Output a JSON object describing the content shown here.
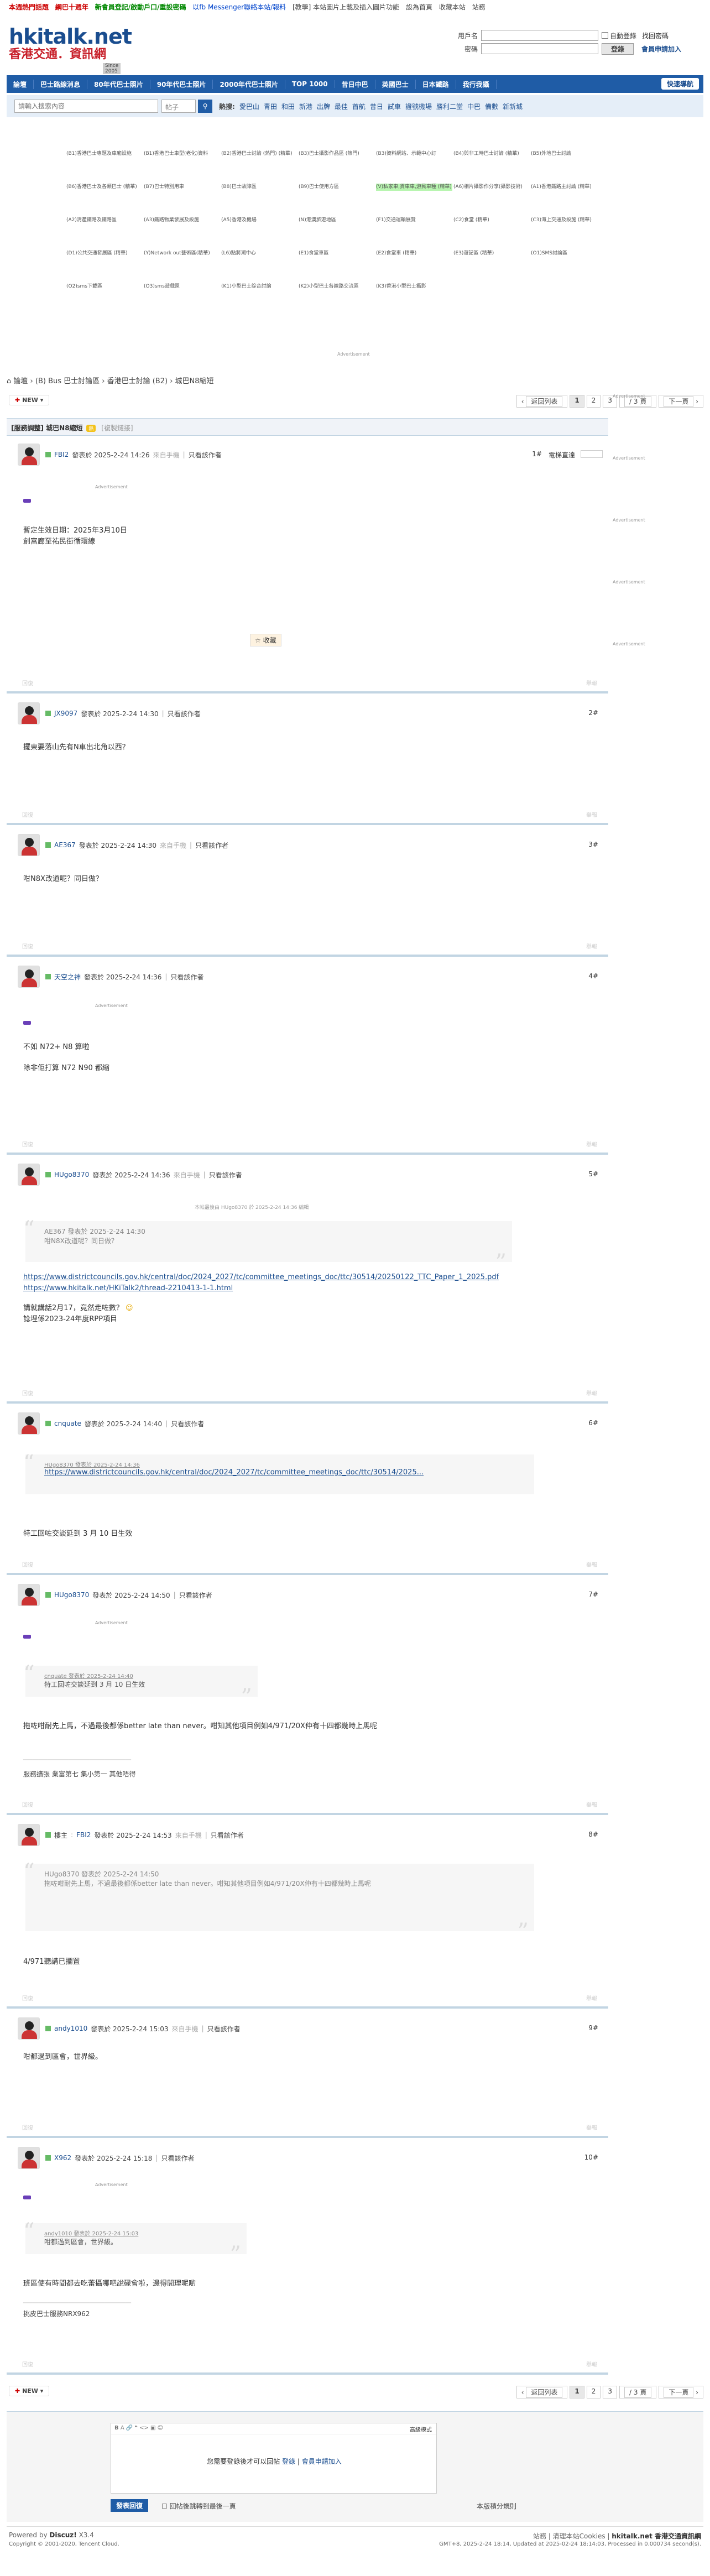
{
  "topnav": {
    "items": [
      "本週熱門話題",
      "網巴十週年",
      "新會員登記/啟動戶口/重設密碼",
      "以fb Messenger聯絡本站/報料",
      "[教學] 本站圖片上載及插入圖片功能",
      "設為首頁",
      "收藏本站",
      "站務"
    ]
  },
  "logo": {
    "title": "hkitalk.net",
    "subtitle": "香港交通．資訊網",
    "since": "Since 2005"
  },
  "login": {
    "user_label": "用戶名",
    "pass_label": "密碼",
    "auto": "自動登錄",
    "forgot": "找回密碼",
    "login_btn": "登錄",
    "register": "會員申請加入"
  },
  "mainnav": {
    "items": [
      "論壇",
      "巴士路線消息",
      "80年代巴士照片",
      "90年代巴士照片",
      "2000年代巴士照片",
      "TOP 1000",
      "昔日中巴",
      "英國巴士",
      "日本鐵路",
      "我行我攝",
      "香港巴士"
    ],
    "quick": "快速導航"
  },
  "search": {
    "placeholder": "請輸入搜索內容",
    "type": "帖子",
    "hot_label": "熱搜:",
    "hot": [
      "愛巴山",
      "青田",
      "和田",
      "新港",
      "出牌",
      "最佳",
      "首航",
      "昔日",
      "試車",
      "證號機場",
      "勝利二堂",
      "中巴",
      "備數",
      "新新城"
    ]
  },
  "forums": [
    "(B1)香港巴士專題及車廂設施",
    "(B1)香港巴士車型(老化)資料",
    "(B2)香港巴士討論 (熱門) (精華)",
    "(B3)巴士攝影作品區 (熱門)",
    "(B3)資料網站、示範中心訂",
    "(B4)與非工時巴士討論 (精華)",
    "(B5)外地巴士討論",
    "(B6)香港巴士及各類巴士 (精華)",
    "(B7)巴士特別用車",
    "(B8)巴士故障區",
    "(B9)巴士使用方區",
    "(V)私家車,貨車車,游民車種 (精華)",
    "(A6)相片攝影作分享(攝影技術)",
    "(A1)香港鐵路主討論 (精華)",
    "(A2)清產鐵路及鐵路區",
    "(A3)鐵路物業發展及設施",
    "(A5)香港及機場",
    "(N)港澳旅遊地區",
    "(F1)交通運輸展覽",
    "(C2)食堂 (精華)",
    "(C3)海上交通及設施 (精華)",
    "(D1)公共交通發展區 (精華)",
    "(Y)Network out藝術區(精華)",
    "(L6)點將潮中心",
    "(E1)食堂車區",
    "(E2)食堂車 (精華)",
    "(E3)遊記區 (精華)",
    "(O1)SMS討論區",
    "(O2)sms下載區",
    "(O3)sms遊戲區",
    "(K1)小型巴士綜合討論",
    "(K2)小型巴士各線路交流區",
    "(K3)香港小型巴士攝影"
  ],
  "ad_label": "Advertisement",
  "breadcrumb": "論壇 › (B) Bus 巴士討論區 › 香港巴士討論 (B2) › 城巴N8縮短",
  "pager": {
    "new": "NEW",
    "back": "返回列表",
    "pages": [
      "1",
      "2",
      "3"
    ],
    "of": "/ 3 頁",
    "next": "下一頁"
  },
  "thread": {
    "title": "[服務調整] 城巴N8縮短",
    "tag": "熱",
    "copy": "[複製鏈接]"
  },
  "posts": [
    {
      "user": "FBI2",
      "time": "發表於 2025-2-24 14:26",
      "via": "來自手機",
      "only": "只看該作者",
      "floor": "1#",
      "extra": "電梯直達",
      "lines": [
        "暫定生效日期：2025年3月10日",
        "創富廊至祐民街循環線"
      ],
      "fav": "收藏"
    },
    {
      "user": "JX9097",
      "time": "發表於 2025-2-24 14:30",
      "via": "",
      "only": "只看該作者",
      "floor": "2#",
      "lines": [
        "擺東要落山先有N車出北角以西？"
      ]
    },
    {
      "user": "AE367",
      "time": "發表於 2025-2-24 14:30",
      "via": "來自手機",
      "only": "只看該作者",
      "floor": "3#",
      "lines": [
        "咁N8X改道呢？同日做？"
      ]
    },
    {
      "user": "天空之神",
      "time": "發表於 2025-2-24 14:36",
      "via": "",
      "only": "只看該作者",
      "floor": "4#",
      "lines": [
        "不如 N72+ N8 算啦",
        "除非佢打算 N72 N90 都縮"
      ]
    },
    {
      "user": "HUgo8370",
      "time": "發表於 2025-2-24 14:36",
      "via": "來自手機",
      "only": "只看該作者",
      "floor": "5#",
      "edit": "本帖最後由 HUgo8370 於 2025-2-24 14:36 編輯",
      "quote_head": "AE367 發表於 2025-2-24 14:30",
      "quote_body": "咁N8X改道呢？同日做？",
      "links": [
        "https://www.districtcouncils.gov.hk/central/doc/2024_2027/tc/committee_meetings_doc/ttc/30514/20250122_TTC_Paper_1_2025.pdf",
        "https://www.hkitalk.net/HKiTalk2/thread-2210413-1-1.html"
      ],
      "lines": [
        "講就講話2月17，竟然走咗數？",
        "諗埋係2023-24年度RPP項目"
      ]
    },
    {
      "user": "cnquate",
      "time": "發表於 2025-2-24 14:40",
      "via": "",
      "only": "只看該作者",
      "floor": "6#",
      "quote_head": "HUgo8370 發表於 2025-2-24 14:36",
      "quote_body": "https://www.districtcouncils.gov.hk/central/doc/2024_2027/tc/committee_meetings_doc/ttc/30514/2025...",
      "lines": [
        "特工回咗交談延到 3 月 10 日生效"
      ]
    },
    {
      "user": "HUgo8370",
      "time": "發表於 2025-2-24 14:50",
      "via": "",
      "only": "只看該作者",
      "floor": "7#",
      "quote_head": "cnquate 發表於 2025-2-24 14:40",
      "quote_body": "特工回咗交談延到 3 月 10 日生效",
      "lines": [
        "拖咗咁耐先上馬，不過最後都係better late than never。咁知其他項目例如4/971/20X仲有十四都幾時上馬呢"
      ],
      "sig": "服務擴張   業富第七   集小第一   其他唔得"
    },
    {
      "user": "FBI2",
      "time": "發表於 2025-2-24 14:53",
      "via": "來自手機",
      "only": "只看該作者",
      "floor": "8#",
      "owner": "樓主",
      "quote_head": "HUgo8370 發表於 2025-2-24 14:50",
      "quote_body": "拖咗咁耐先上馬，不過最後都係better late than never。咁知其他項目例如4/971/20X仲有十四都幾時上馬呢",
      "lines": [
        "4/971聽講已擱置"
      ]
    },
    {
      "user": "andy1010",
      "time": "發表於 2025-2-24 15:03",
      "via": "來自手機",
      "only": "只看該作者",
      "floor": "9#",
      "lines": [
        "咁都過到區會，世界級。"
      ]
    },
    {
      "user": "X962",
      "time": "發表於 2025-2-24 15:18",
      "via": "",
      "only": "只看該作者",
      "floor": "10#",
      "quote_head": "andy1010 發表於 2025-2-24 15:03",
      "quote_body": "咁都過到區會，世界級。",
      "lines": [
        "班區使有時間都去吃蕾攝哪吧說碌會啦，邊得閒理呢啲"
      ],
      "sig2": "挑皮巴士服務NRX962"
    }
  ],
  "reply": {
    "mode": "高級模式",
    "msg": "您需要登錄後才可以回帖",
    "login": "登錄",
    "sep": "|",
    "register": "會員申請加入",
    "submit": "發表回復",
    "check": "回帖後跳轉到最後一頁",
    "rule": "本版積分規則"
  },
  "footer": {
    "powered": "Powered by",
    "discuz": "Discuz!",
    "ver": "X3.4",
    "copy": "Copyright © 2001-2020, Tencent Cloud.",
    "links": "站務 | 清理本站Cookies | ",
    "brand": "hkitalk.net 香港交通資訊網",
    "time": "GMT+8, 2025-2-24 18:14, Updated at 2025-02-24 18:14:03, Processed in 0.000734 second(s)."
  },
  "colors": {
    "accent": "#1f5ca6",
    "border": "#c2d5e3",
    "brand_red": "#c8202a"
  }
}
